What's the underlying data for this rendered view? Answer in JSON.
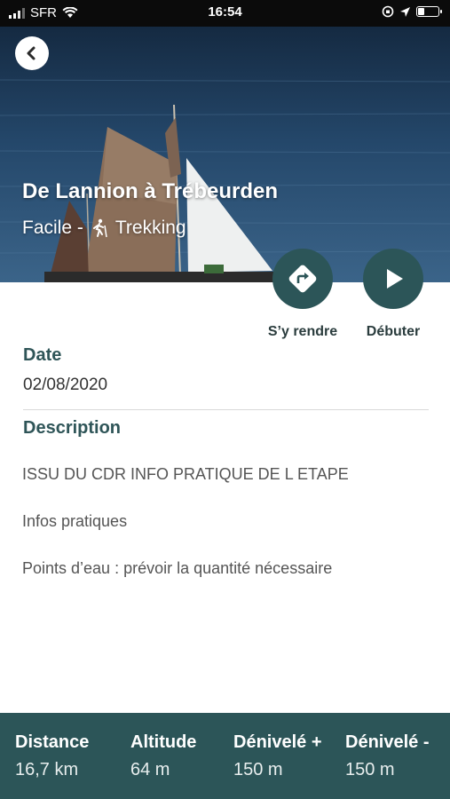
{
  "status_bar": {
    "carrier": "SFR",
    "time": "16:54",
    "battery_level": 0.3
  },
  "hero": {
    "title": "De Lannion à Trébeurden",
    "difficulty": "Facile -",
    "activity": "Trekking",
    "activity_icon": "hiker-icon"
  },
  "actions": {
    "goto_label": "S’y rendre",
    "start_label": "Débuter"
  },
  "date": {
    "label": "Date",
    "value": "02/08/2020"
  },
  "description": {
    "label": "Description",
    "lines": [
      "ISSU DU CDR INFO PRATIQUE DE L ETAPE",
      "Infos pratiques",
      "Points d’eau : prévoir la quantité nécessaire"
    ]
  },
  "stats": [
    {
      "label": "Distance",
      "value": "16,7 km"
    },
    {
      "label": "Altitude",
      "value": "64 m"
    },
    {
      "label": "Dénivelé +",
      "value": "150 m"
    },
    {
      "label": "Dénivelé -",
      "value": "150 m"
    }
  ],
  "colors": {
    "accent": "#2c5558",
    "heading": "#2f5558",
    "status_bar": "#0b0b0b"
  }
}
